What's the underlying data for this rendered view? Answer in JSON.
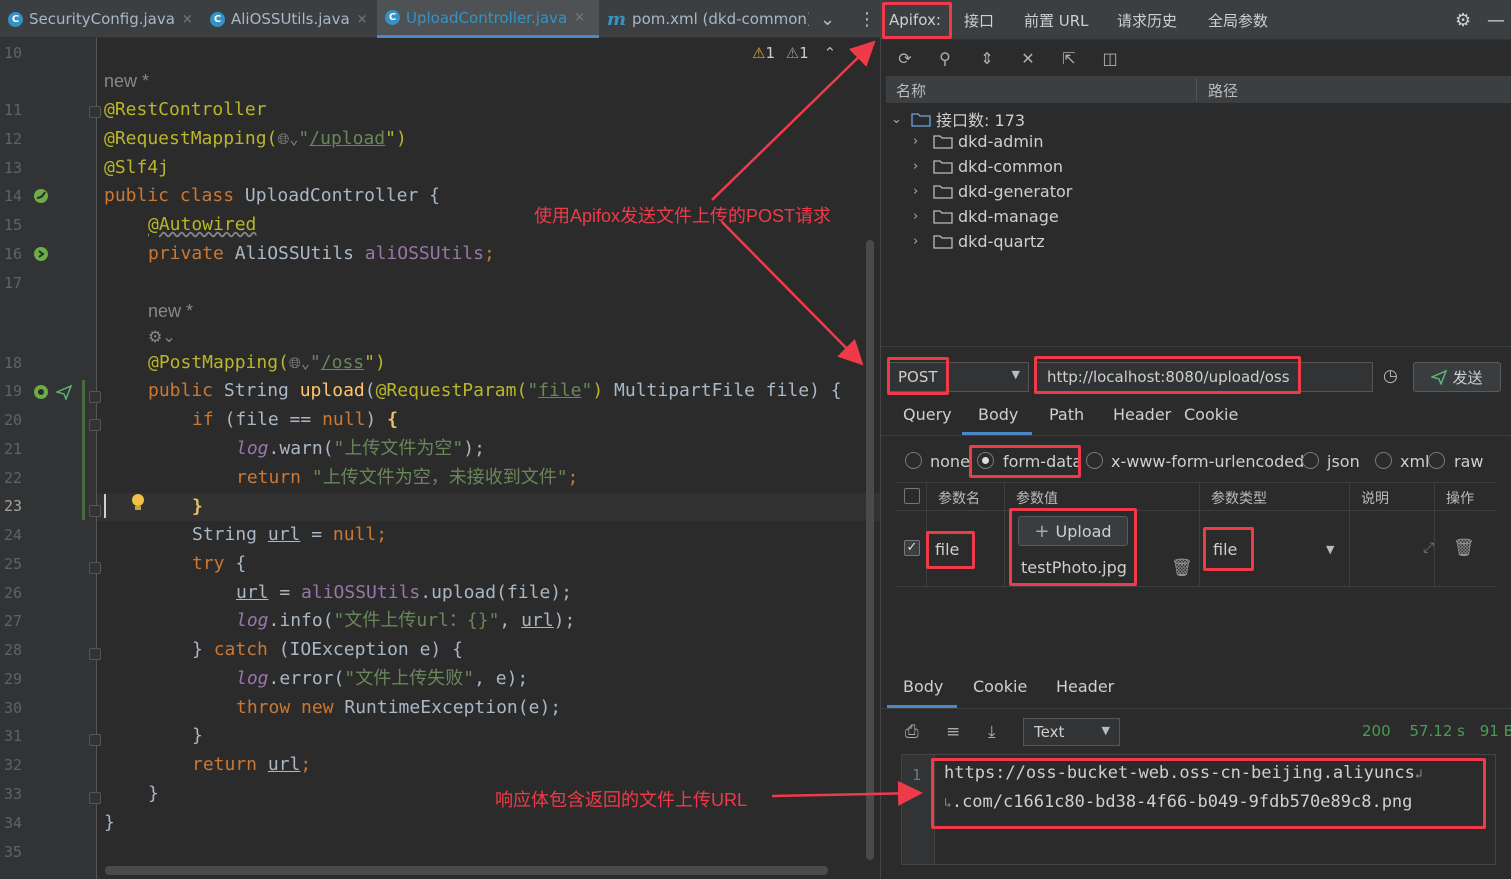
{
  "editor_tabs": [
    {
      "label": "SecurityConfig.java",
      "icon": "class-icon",
      "close": "×"
    },
    {
      "label": "AliOSSUtils.java",
      "icon": "class-icon",
      "close": "×"
    },
    {
      "label": "UploadController.java",
      "icon": "class-icon",
      "close": "×"
    },
    {
      "label": "pom.xml (dkd-common)",
      "icon": "maven-icon",
      "close": ""
    }
  ],
  "tab_overflow": "⌄",
  "tab_menu": "⋮",
  "warnings": {
    "warn_count": "1",
    "weak_count": "1"
  },
  "line_numbers": [
    "10",
    "11",
    "12",
    "13",
    "14",
    "15",
    "16",
    "17",
    "18",
    "19",
    "20",
    "21",
    "22",
    "23",
    "24",
    "25",
    "26",
    "27",
    "28",
    "29",
    "30",
    "31",
    "32",
    "33",
    "34",
    "35"
  ],
  "hints": {
    "new1": "new *",
    "new2": "new *"
  },
  "code": {
    "l11": "@RestController",
    "l12_a": "@RequestMapping(",
    "l12_b": "\"",
    "l12_c": "/upload",
    "l12_d": "\")",
    "l13": "@Slf4j",
    "l14_kw": "public class ",
    "l14_rest": "UploadController {",
    "l15": "@Autowired",
    "l16_kw": "private ",
    "l16_t": "AliOSSUtils ",
    "l16_f": "aliOSSUtils",
    "l16_e": ";",
    "l18_a": "@PostMapping(",
    "l18_b": "\"",
    "l18_c": "/oss",
    "l18_d": "\")",
    "l19_kw": "public ",
    "l19_t": "String ",
    "l19_fn": "upload",
    "l19_a": "(",
    "l19_an": "@RequestParam(",
    "l19_s1": "\"",
    "l19_s2": "file",
    "l19_s3": "\"",
    "l19_an2": ")",
    "l19_rest": " MultipartFile file) {",
    "l20_kw": "if ",
    "l20_rest": "(file == ",
    "l20_kw2": "null",
    "l20_e": ") ",
    "l20_br": "{",
    "l21_lg": "log",
    "l21_a": ".warn(",
    "l21_s": "\"上传文件为空\"",
    "l21_e": ");",
    "l22_kw": "return ",
    "l22_s": "\"上传文件为空，未接收到文件\"",
    "l22_e": ";",
    "l23_br": "}",
    "l24_t": "String ",
    "l24_v": "url",
    "l24_m": " = ",
    "l24_kw": "null",
    "l24_e": ";",
    "l25_kw": "try ",
    "l25_e": "{",
    "l26_v": "url",
    "l26_m": " = ",
    "l26_f": "aliOSSUtils",
    "l26_e": ".upload(file);",
    "l27_lg": "log",
    "l27_a": ".info(",
    "l27_s": "\"文件上传url：{}\"",
    "l27_c": ", ",
    "l27_v": "url",
    "l27_e": ");",
    "l28_a": "} ",
    "l28_kw": "catch ",
    "l28_e": "(IOException e) {",
    "l29_lg": "log",
    "l29_a": ".error(",
    "l29_s": "\"文件上传失败\"",
    "l29_e": ", e);",
    "l30_kw": "throw new ",
    "l30_e": "RuntimeException(e);",
    "l31": "}",
    "l32_kw": "return ",
    "l32_v": "url",
    "l32_e": ";",
    "l33": "}",
    "l34": "}"
  },
  "apifox": {
    "tabs": [
      "Apifox:",
      "接口",
      "前置 URL",
      "请求历史",
      "全局参数"
    ],
    "tree_headers": {
      "name": "名称",
      "path": "路径"
    },
    "root": "接口数: 173",
    "modules": [
      "dkd-admin",
      "dkd-common",
      "dkd-generator",
      "dkd-manage",
      "dkd-quartz"
    ],
    "method": "POST",
    "url": "http://localhost:8080/upload/oss",
    "send_label": "发送",
    "req_tabs": [
      "Query",
      "Body",
      "Path",
      "Header",
      "Cookie"
    ],
    "body_types": [
      "none",
      "form-data",
      "x-www-form-urlencoded",
      "json",
      "xml",
      "raw"
    ],
    "table_headers": [
      "参数名",
      "参数值",
      "参数类型",
      "说明",
      "操作"
    ],
    "param": {
      "name": "file",
      "upload_label": "Upload",
      "file_name": "testPhoto.jpg",
      "type": "file"
    },
    "resp_tabs": [
      "Body",
      "Cookie",
      "Header"
    ],
    "format": "Text",
    "status": {
      "code": "200",
      "time": "57.12 s",
      "size": "91 B"
    },
    "resp_line_no": "1",
    "resp_line1": "https://oss-bucket-web.oss-cn-beijing.aliyuncs",
    "resp_line2": ".com/c1661c80-bd38-4f66-b049-9fdb570e89c8.png"
  },
  "annotations": {
    "top": "使用Apifox发送文件上传的POST请求",
    "bottom": "响应体包含返回的文件上传URL"
  },
  "colors": {
    "annotation": "#ef3b49",
    "status_ok": "#499c54",
    "send_button": "#5fb878",
    "accent": "#4a88c7"
  }
}
